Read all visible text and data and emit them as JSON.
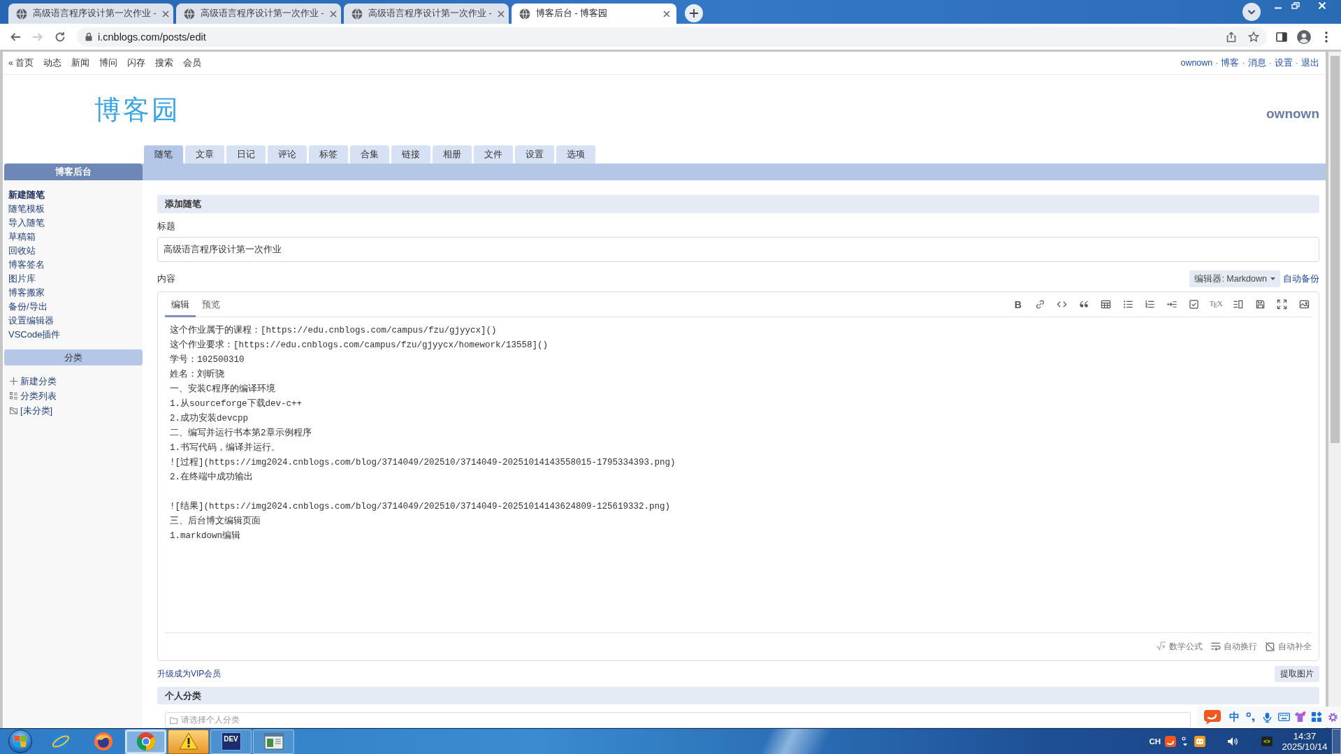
{
  "browser": {
    "tabs": [
      {
        "title": "高级语言程序设计第一次作业 -",
        "selected": false
      },
      {
        "title": "高级语言程序设计第一次作业 -",
        "selected": false
      },
      {
        "title": "高级语言程序设计第一次作业 -",
        "selected": false
      },
      {
        "title": "博客后台 - 博客园",
        "selected": true
      }
    ],
    "nav_buttons": [
      {
        "kind": "back",
        "disabled": false
      },
      {
        "kind": "forward",
        "disabled": true
      },
      {
        "kind": "reload",
        "disabled": false
      }
    ],
    "url": "i.cnblogs.com/posts/edit"
  },
  "top_nav": {
    "links": [
      "« 首页",
      "动态",
      "新闻",
      "博问",
      "闪存",
      "搜索",
      "会员"
    ],
    "account": [
      {
        "kind": "link",
        "text": "ownown"
      },
      {
        "kind": "separator",
        "text": "·"
      },
      {
        "kind": "link",
        "text": "博客"
      },
      {
        "kind": "separator",
        "text": "·"
      },
      {
        "kind": "link",
        "text": "消息"
      },
      {
        "kind": "separator",
        "text": "·"
      },
      {
        "kind": "link",
        "text": "设置"
      },
      {
        "kind": "separator",
        "text": "·"
      },
      {
        "kind": "link",
        "text": "退出"
      }
    ]
  },
  "header": {
    "logo": "博客园",
    "blog_name": "ownown"
  },
  "nav_tabs": [
    {
      "label": "随笔",
      "selected": true
    },
    {
      "label": "文章",
      "selected": false
    },
    {
      "label": "日记",
      "selected": false
    },
    {
      "label": "评论",
      "selected": false
    },
    {
      "label": "标签",
      "selected": false
    },
    {
      "label": "合集",
      "selected": false
    },
    {
      "label": "链接",
      "selected": false
    },
    {
      "label": "相册",
      "selected": false
    },
    {
      "label": "文件",
      "selected": false
    },
    {
      "label": "设置",
      "selected": false
    },
    {
      "label": "选项",
      "selected": false
    }
  ],
  "sidebar": {
    "title": "博客后台",
    "items": [
      {
        "label": "新建随笔",
        "selected": true
      },
      {
        "label": "随笔模板",
        "selected": false
      },
      {
        "label": "导入随笔",
        "selected": false
      },
      {
        "label": "草稿箱",
        "selected": false
      },
      {
        "label": "回收站",
        "selected": false
      },
      {
        "label": "博客签名",
        "selected": false
      },
      {
        "label": "图片库",
        "selected": false
      },
      {
        "label": "博客搬家",
        "selected": false
      },
      {
        "label": "备份/导出",
        "selected": false
      },
      {
        "label": "设置编辑器",
        "selected": false
      },
      {
        "label": "VSCode插件",
        "selected": false
      }
    ],
    "category_title": "分类",
    "categories": [
      {
        "kind": "add",
        "label": "新建分类"
      },
      {
        "kind": "list",
        "label": "分类列表"
      },
      {
        "kind": "folder",
        "label": "[未分类]"
      }
    ]
  },
  "post_form": {
    "section_title": "添加随笔",
    "title_label": "标题",
    "title_value": "高级语言程序设计第一次作业",
    "content_label": "内容",
    "editor_select": "编辑器: Markdown",
    "autosave": "自动备份",
    "editor_tabs": [
      {
        "label": "编辑",
        "selected": true
      },
      {
        "label": "预览",
        "selected": false
      }
    ],
    "toolbar": [
      {
        "kind": "bold",
        "label": "B"
      },
      {
        "kind": "link"
      },
      {
        "kind": "code"
      },
      {
        "kind": "quote"
      },
      {
        "kind": "table"
      },
      {
        "kind": "bullet_list"
      },
      {
        "kind": "numbered_list"
      },
      {
        "kind": "indent"
      },
      {
        "kind": "task"
      },
      {
        "kind": "tex",
        "label": "T$_{E}$X"
      },
      {
        "kind": "columns"
      },
      {
        "kind": "save"
      },
      {
        "kind": "fullscreen"
      },
      {
        "kind": "image"
      }
    ],
    "content_blocks": [
      [
        "这个作业属于的课程：[https://edu.cnblogs.com/campus/fzu/gjyycx]()",
        "这个作业要求：[https://edu.cnblogs.com/campus/fzu/gjyycx/homework/13558]()",
        "学号：102500310",
        "姓名：刘昕骁",
        "一、安装C程序的编译环境",
        "1.从sourceforge下载dev-c++",
        "2.成功安装devcpp",
        "二、编写并运行书本第2章示例程序",
        "1.书写代码，编译并运行。",
        "![过程](https://img2024.cnblogs.com/blog/3714049/202510/3714049-20251014143558015-1795334393.png)",
        "2.在终端中成功输出"
      ],
      [
        "![结果](https://img2024.cnblogs.com/blog/3714049/202510/3714049-20251014143624809-125619332.png)",
        "三、后台博文编辑页面",
        "1.markdown编辑"
      ]
    ],
    "options": [
      {
        "kind": "math",
        "label": "数学公式"
      },
      {
        "kind": "wrap",
        "label": "自动换行"
      },
      {
        "kind": "complete",
        "label": "自动补全"
      }
    ],
    "vip_link": "升级成为VIP会员",
    "extract_button": "提取图片",
    "category_section": "个人分类",
    "category_placeholder": "请选择个人分类"
  },
  "ime_toolbar": [
    {
      "kind": "logo"
    },
    {
      "kind": "mode",
      "label": "中"
    },
    {
      "kind": "punct"
    },
    {
      "kind": "mic"
    },
    {
      "kind": "keyboard"
    },
    {
      "kind": "skin"
    },
    {
      "kind": "toolbox"
    },
    {
      "kind": "settings"
    }
  ],
  "taskbar": {
    "apps": [
      {
        "kind": "ie",
        "running": false,
        "selected": false,
        "alert": false
      },
      {
        "kind": "firefox",
        "running": false,
        "selected": false,
        "alert": false
      },
      {
        "kind": "chrome",
        "running": true,
        "selected": true,
        "alert": false
      },
      {
        "kind": "warning",
        "running": true,
        "selected": false,
        "alert": true
      },
      {
        "kind": "devcpp",
        "label": "DEV",
        "running": true,
        "selected": false,
        "alert": false
      },
      {
        "kind": "window",
        "running": true,
        "selected": false,
        "alert": false
      }
    ],
    "language": "CH",
    "time": "14:37",
    "date": "2025/10/14"
  }
}
